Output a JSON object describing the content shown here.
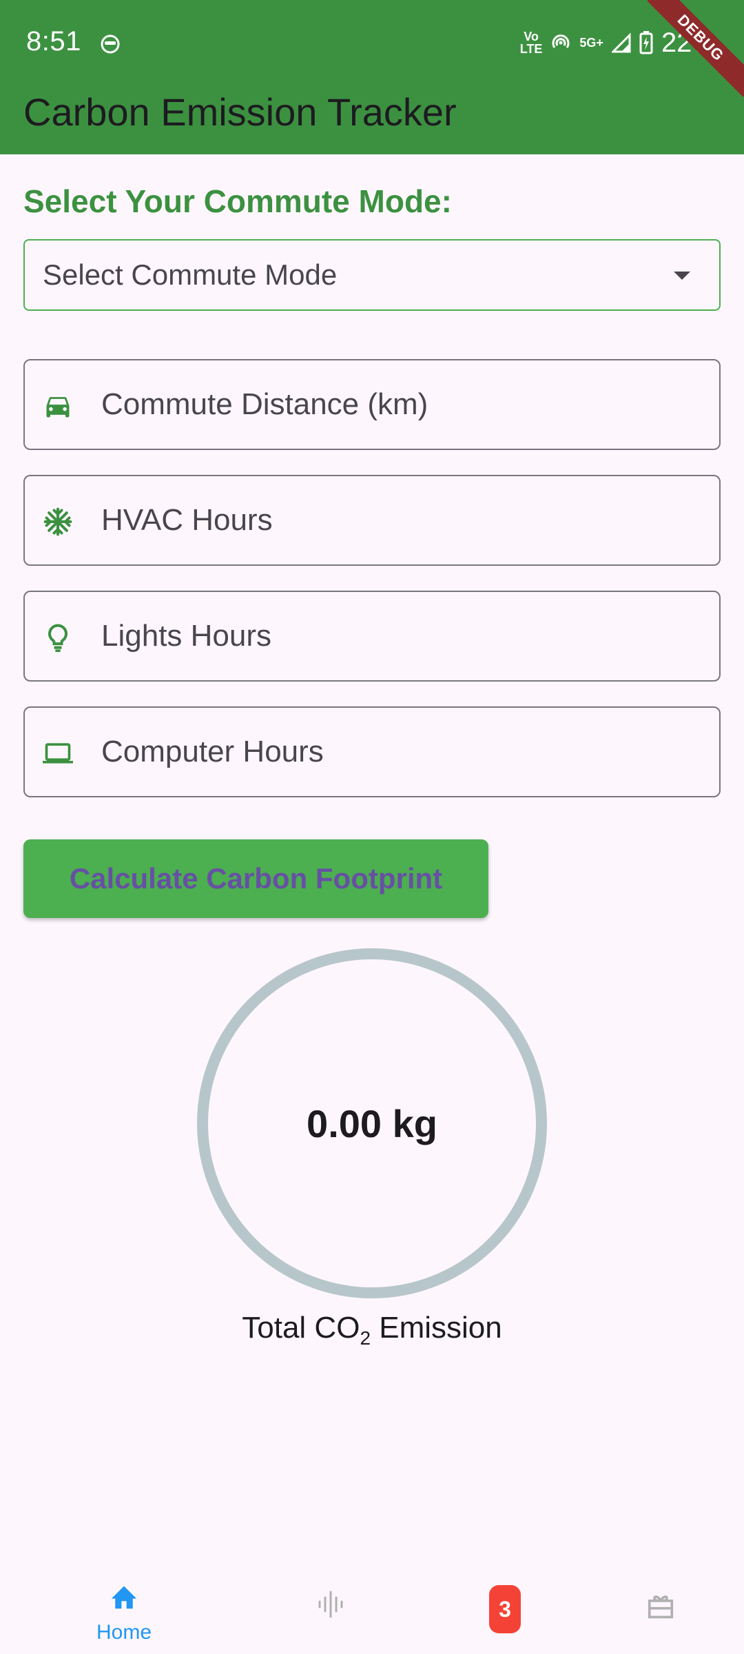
{
  "status_bar": {
    "time": "8:51",
    "network_top": "Vo",
    "network_bottom": "LTE",
    "network_type": "5G+",
    "battery": "22%"
  },
  "debug_banner": "DEBUG",
  "app_bar": {
    "title": "Carbon Emission Tracker"
  },
  "commute": {
    "heading": "Select Your Commute Mode:",
    "dropdown_placeholder": "Select Commute Mode"
  },
  "fields": {
    "distance": {
      "label": "Commute Distance (km)",
      "icon": "car-icon"
    },
    "hvac": {
      "label": "HVAC Hours",
      "icon": "snowflake-icon"
    },
    "lights": {
      "label": "Lights Hours",
      "icon": "lightbulb-icon"
    },
    "computer": {
      "label": "Computer Hours",
      "icon": "laptop-icon"
    }
  },
  "calculate_button": "Calculate Carbon Footprint",
  "result": {
    "value": "0.00 kg",
    "label_prefix": "Total CO",
    "label_subscript": "2",
    "label_suffix": " Emission"
  },
  "bottom_nav": {
    "home_label": "Home",
    "badge_count": "3"
  },
  "colors": {
    "primary_green": "#3C9140",
    "button_green": "#4CAF50",
    "button_text": "#6750A4",
    "ring_gray": "#B7C6CB",
    "nav_active": "#2196F3",
    "badge_red": "#F44336",
    "background": "#FDF7FD"
  }
}
